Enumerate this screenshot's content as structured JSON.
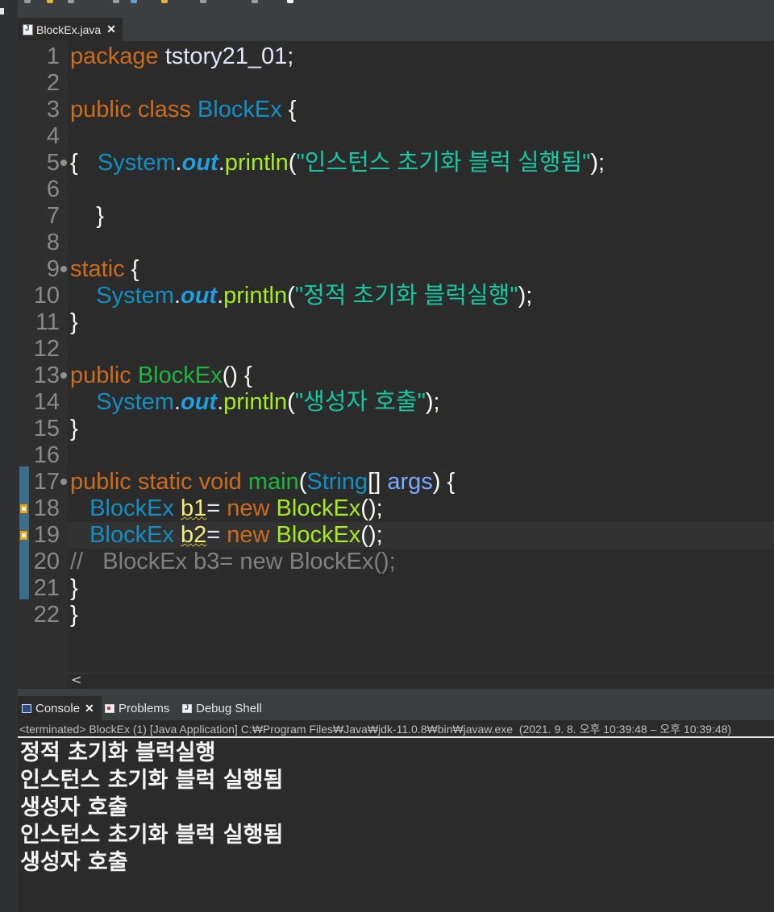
{
  "editor_tab": {
    "filename": "BlockEx.java",
    "close_glyph": "✕"
  },
  "code": {
    "line_numbers": [
      "1",
      "2",
      "3",
      "4",
      "5",
      "6",
      "7",
      "8",
      "9",
      "10",
      "11",
      "12",
      "13",
      "14",
      "15",
      "16",
      "17",
      "18",
      "19",
      "20",
      "21",
      "22"
    ],
    "l1": {
      "kw": "package",
      "rest": " tstory21_01;"
    },
    "l3": {
      "kw": "public class",
      "cls": "BlockEx",
      "rest": " {"
    },
    "l5": {
      "brace": "{   ",
      "sys": "System",
      "dot1": ".",
      "out": "out",
      "dot2": ".",
      "m": "println",
      "lp": "(",
      "s": "\"인스턴스 초기화 블럭 실행됨\"",
      "rp": ");"
    },
    "l7": {
      "brace": "    }"
    },
    "l9": {
      "kw": "static",
      "rest": " {"
    },
    "l10": {
      "indent": "    ",
      "sys": "System",
      "dot1": ".",
      "out": "out",
      "dot2": ".",
      "m": "println",
      "lp": "(",
      "s": "\"정적 초기화 블럭실행\"",
      "rp": ");"
    },
    "l11": {
      "brace": "}"
    },
    "l13": {
      "kw": "public",
      "name": "BlockEx",
      "rest": "() {"
    },
    "l14": {
      "indent": "    ",
      "sys": "System",
      "dot1": ".",
      "out": "out",
      "dot2": ".",
      "m": "println",
      "lp": "(",
      "s": "\"생성자 호출\"",
      "rp": ");"
    },
    "l15": {
      "brace": "}"
    },
    "l17": {
      "kw": "public static void",
      "m": "main",
      "lp": "(",
      "type": "String",
      "arr": "[] ",
      "arg": "args",
      "rest": ") {"
    },
    "l18": {
      "indent": "   ",
      "cls": "BlockEx",
      "var": "b1",
      "eq": "= ",
      "kw": "new",
      "ctor": "BlockEx",
      "rest": "();"
    },
    "l19": {
      "indent": "   ",
      "cls": "BlockEx",
      "var": "b2",
      "eq": "= ",
      "kw": "new",
      "ctor": "BlockEx",
      "rest": "();"
    },
    "l20": {
      "comment": "//   BlockEx b3= new BlockEx();"
    },
    "l21": {
      "brace": "}"
    },
    "l22": {
      "brace": "}"
    }
  },
  "scroll_left_glyph": "<",
  "console_tabs": [
    {
      "label": "Console",
      "close": "✕"
    },
    {
      "label": "Problems"
    },
    {
      "label": "Debug Shell"
    }
  ],
  "console": {
    "status": "<terminated> BlockEx (1) [Java Application] C:₩Program Files₩Java₩jdk-11.0.8₩bin₩javaw.exe  (2021. 9. 8. 오후 10:39:48 – 오후 10:39:48)",
    "output": [
      "정적 초기화 블럭실행",
      "인스턴스 초기화 블럭 실행됨",
      "생성자 호출",
      "인스턴스 초기화 블럭 실행됨",
      "생성자 호출"
    ]
  },
  "colors": {
    "keyword": "#cc6c1d",
    "class": "#1290c3",
    "method": "#a7ec21",
    "string": "#17c6a3",
    "variable": "#f3ec79",
    "comment": "#808080",
    "background": "#2b2b2b"
  }
}
